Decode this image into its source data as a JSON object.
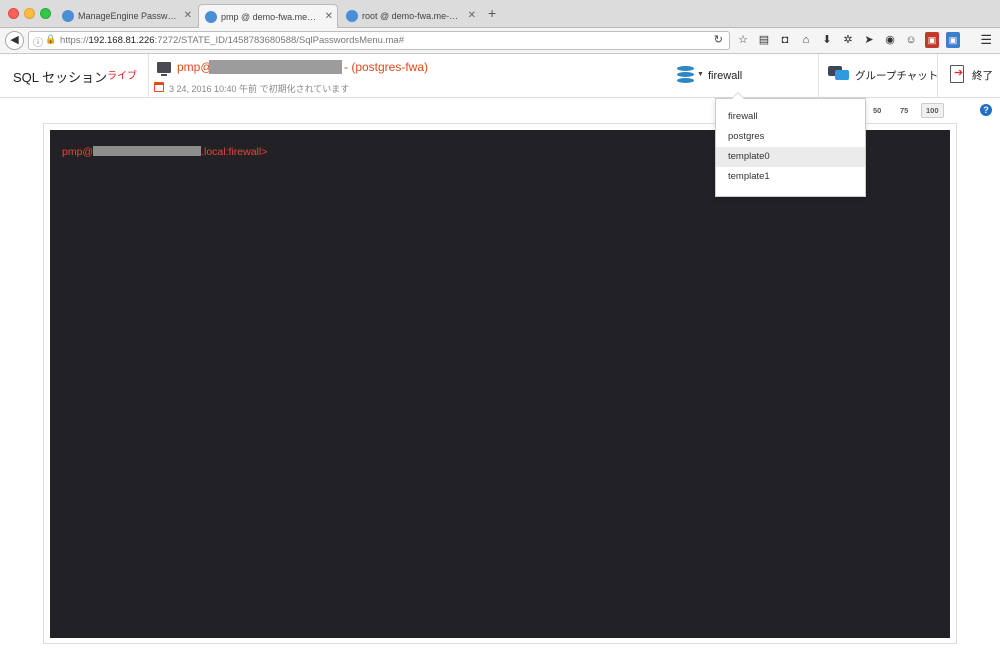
{
  "browser": {
    "tabs": [
      {
        "title": "ManageEngine Password M...",
        "active": false
      },
      {
        "title": "pmp @ demo-fwa.me-deve...",
        "active": true
      },
      {
        "title": "root @ demo-fwa.me-devel...",
        "active": false
      }
    ],
    "close_glyph": "✕",
    "newtab_glyph": "+",
    "url_prefix": "https://",
    "url_host": "192.168.81.226",
    "url_rest": ":7272/STATE_ID/1458783680588/SqlPasswordsMenu.ma#",
    "icons": [
      "back-icon",
      "info-icon",
      "lock-icon",
      "reload-icon",
      "star-icon",
      "reader-icon",
      "pocket-icon",
      "home-icon",
      "download-icon",
      "settings-icon",
      "send-icon",
      "sync-icon",
      "face-icon",
      "addon-red-icon",
      "addon-blue-icon",
      "menu-icon"
    ]
  },
  "header": {
    "session_title": "SQL セッション",
    "live_badge": "ライブ",
    "conn_user": "pmp@",
    "conn_resource": "- (postgres-fwa)",
    "init_text": "3 24, 2016 10:40 午前 で初期化されています",
    "current_db": "firewall",
    "group_chat": "グループチャット",
    "exit": "終了"
  },
  "zoom": {
    "levels": [
      "50",
      "75",
      "100"
    ],
    "selected": "100"
  },
  "help_glyph": "?",
  "terminal": {
    "prompt_user": "pmp@",
    "prompt_suffix": ".local:firewall>"
  },
  "db_dropdown": {
    "items": [
      "firewall",
      "postgres",
      "template0",
      "template1"
    ],
    "highlighted": "template0"
  },
  "colors": {
    "accent": "#e2491b",
    "live": "#e21c1c",
    "terminal_bg": "#222126",
    "prompt": "#e8473c",
    "db_icon": "#2f86c4",
    "help": "#1f6fc5"
  }
}
